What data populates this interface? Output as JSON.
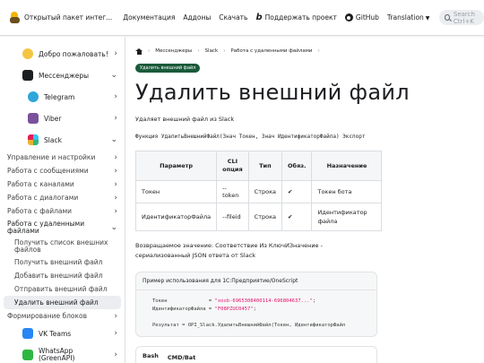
{
  "header": {
    "brand": "Открытый пакет интег...",
    "nav": [
      "Документация",
      "Аддоны",
      "Скачать"
    ],
    "donate": "Поддержать проект",
    "github": "GitHub",
    "translation": "Translation",
    "search_placeholder": "Search Ctrl+K"
  },
  "sidebar": {
    "welcome": "Добро пожаловать!",
    "messengers": "Мессенджеры",
    "telegram": "Telegram",
    "viber": "Viber",
    "slack": "Slack",
    "slack_sub": [
      "Управление и настройки",
      "Работа с сообщениями",
      "Работа с каналами",
      "Работа с диалогами",
      "Работа с файлами"
    ],
    "remote_files": [
      "Работа с удаленными",
      "файлами"
    ],
    "remote_sub": [
      "Получить список внешних файлов",
      "Получить внешний файл",
      "Добавить внешний файл",
      "Отправить внешний файл",
      "Удалить внешний файл"
    ],
    "blocks": "Формирование блоков",
    "vk": "VK Teams",
    "whatsapp": [
      "WhatsApp",
      "(GreenAPI)"
    ]
  },
  "breadcrumbs": [
    "Мессенджеры",
    "Slack",
    "Работа с удаленными файлами"
  ],
  "badge": "Удалить внешний файл",
  "title": "Удалить внешний файл",
  "description": "Удаляет внешний файл из Slack",
  "signature": "Функция УдалитьВнешнийФайл(Знач Токен, Знач ИдентификаторФайла) Экспорт",
  "table": {
    "headers": [
      "Параметр",
      "CLI опция",
      "Тип",
      "Обяз.",
      "Назначение"
    ],
    "rows": [
      [
        "Токен",
        "--token",
        "Строка",
        "✔",
        "Токен бота"
      ],
      [
        "ИдентификаторФайла",
        "--fileid",
        "Строка",
        "✔",
        "Идентификатор файла"
      ]
    ]
  },
  "return_value": "Возвращаемое значение: Соответствие Из КлючИЗначение - сериализованный JSON ответа от Slack",
  "example": {
    "caption": "Пример использования для 1С:Предприятие/OneScript",
    "line1_pre": "Токен              = ",
    "line1_str": "\"xoxb-6965308400114-696804637...\"",
    "line1_end": ";",
    "line2_pre": "ИдентификаторФайла = ",
    "line2_str": "\"F08PZUC0457\"",
    "line2_end": ";",
    "line3": "Результат = OPI_Slack.УдалитьВнешнийФайл(Токен, ИдентификаторФайл"
  },
  "tabs": [
    "Bash",
    "CMD/Bat"
  ],
  "colors": {
    "accent": "#1a5a3a"
  }
}
